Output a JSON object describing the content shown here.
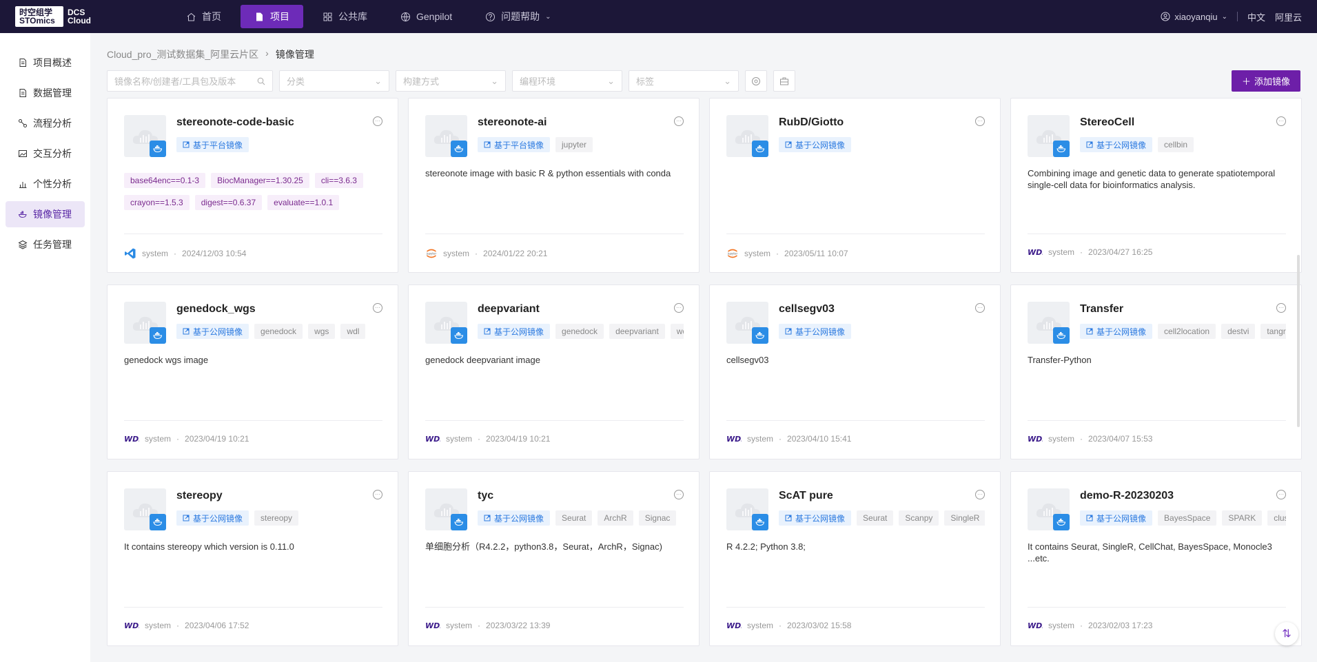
{
  "logo": {
    "cn": "时空组学",
    "en": "STOmics",
    "product_line1": "DCS",
    "product_line2": "Cloud"
  },
  "nav": [
    {
      "label": "首页",
      "icon": "home-icon",
      "active": false
    },
    {
      "label": "项目",
      "icon": "document-icon",
      "active": true
    },
    {
      "label": "公共库",
      "icon": "grid-icon",
      "active": false
    },
    {
      "label": "Genpilot",
      "icon": "globe-icon",
      "active": false
    },
    {
      "label": "问题帮助",
      "icon": "help-icon",
      "active": false
    }
  ],
  "user": {
    "name": "xiaoyanqiu",
    "lang": "中文",
    "region": "阿里云"
  },
  "sidebar": [
    {
      "label": "项目概述",
      "icon": "file-icon"
    },
    {
      "label": "数据管理",
      "icon": "file-icon"
    },
    {
      "label": "流程分析",
      "icon": "flow-icon"
    },
    {
      "label": "交互分析",
      "icon": "image-icon"
    },
    {
      "label": "个性分析",
      "icon": "chart-icon"
    },
    {
      "label": "镜像管理",
      "icon": "docker-icon",
      "active": true
    },
    {
      "label": "任务管理",
      "icon": "layers-icon"
    }
  ],
  "breadcrumb": {
    "project": "Cloud_pro_测试数据集_阿里云片区",
    "current": "镜像管理"
  },
  "filters": {
    "search_placeholder": "镜像名称/创建者/工具包及版本",
    "category": "分类",
    "build": "构建方式",
    "env": "编程环境",
    "tag": "标签"
  },
  "add_button": "添加镜像",
  "cards": [
    {
      "title": "stereonote-code-basic",
      "base": "基于平台镜像",
      "tags": [],
      "packages": [
        "base64enc==0.1-3",
        "BiocManager==1.30.25",
        "cli==3.6.3",
        "crayon==1.5.3",
        "digest==0.6.37",
        "evaluate==1.0.1"
      ],
      "desc": "",
      "logo": "vscode",
      "owner": "system",
      "time": "2024/12/03 10:54"
    },
    {
      "title": "stereonote-ai",
      "base": "基于平台镜像",
      "tags": [
        "jupyter"
      ],
      "packages": [],
      "desc": "stereonote image with basic R & python essentials with conda",
      "logo": "jupyter",
      "owner": "system",
      "time": "2024/01/22 20:21"
    },
    {
      "title": "RubD/Giotto",
      "base": "基于公网镜像",
      "tags": [],
      "packages": [],
      "desc": "",
      "logo": "jupyter",
      "owner": "system",
      "time": "2023/05/11 10:07"
    },
    {
      "title": "StereoCell",
      "base": "基于公网镜像",
      "tags": [
        "cellbin"
      ],
      "packages": [],
      "desc": "Combining image and genetic data to generate spatiotemporal single-cell data for bioinformatics analysis.",
      "logo": "wdl",
      "owner": "system",
      "time": "2023/04/27 16:25"
    },
    {
      "title": "genedock_wgs",
      "base": "基于公网镜像",
      "tags": [
        "genedock",
        "wgs",
        "wdl"
      ],
      "packages": [],
      "desc": "genedock wgs image",
      "logo": "wdl",
      "owner": "system",
      "time": "2023/04/19 10:21"
    },
    {
      "title": "deepvariant",
      "base": "基于公网镜像",
      "tags": [
        "genedock",
        "deepvariant",
        "wdl"
      ],
      "packages": [],
      "desc": "genedock deepvariant image",
      "logo": "wdl",
      "owner": "system",
      "time": "2023/04/19 10:21"
    },
    {
      "title": "cellsegv03",
      "base": "基于公网镜像",
      "tags": [],
      "packages": [],
      "desc": "cellsegv03",
      "logo": "wdl",
      "owner": "system",
      "time": "2023/04/10 15:41"
    },
    {
      "title": "Transfer",
      "base": "基于公网镜像",
      "tags": [
        "cell2location",
        "destvi",
        "tangram"
      ],
      "packages": [],
      "desc": "Transfer-Python",
      "logo": "wdl",
      "owner": "system",
      "time": "2023/04/07 15:53"
    },
    {
      "title": "stereopy",
      "base": "基于公网镜像",
      "tags": [
        "stereopy"
      ],
      "packages": [],
      "desc": "It contains stereopy which version is 0.11.0",
      "logo": "wdl",
      "owner": "system",
      "time": "2023/04/06 17:52"
    },
    {
      "title": "tyc",
      "base": "基于公网镜像",
      "tags": [
        "Seurat",
        "ArchR",
        "Signac"
      ],
      "packages": [],
      "desc": "单细胞分析（R4.2.2，python3.8，Seurat，ArchR，Signac)",
      "logo": "wdl",
      "owner": "system",
      "time": "2023/03/22 13:39"
    },
    {
      "title": "ScAT pure",
      "base": "基于公网镜像",
      "tags": [
        "Seurat",
        "Scanpy",
        "SingleR"
      ],
      "packages": [],
      "desc": "R 4.2.2; Python 3.8;",
      "logo": "wdl",
      "owner": "system",
      "time": "2023/03/02 15:58"
    },
    {
      "title": "demo-R-20230203",
      "base": "基于公网镜像",
      "tags": [
        "BayesSpace",
        "SPARK",
        "cluster"
      ],
      "packages": [],
      "desc": "It contains Seurat, SingleR, CellChat, BayesSpace, Monocle3 ...etc.",
      "logo": "wdl",
      "owner": "system",
      "time": "2023/02/03 17:23"
    }
  ],
  "colors": {
    "topbar": "#1c1738",
    "accent": "#6d2bb8",
    "tag_blue": "#2c7ae0"
  }
}
